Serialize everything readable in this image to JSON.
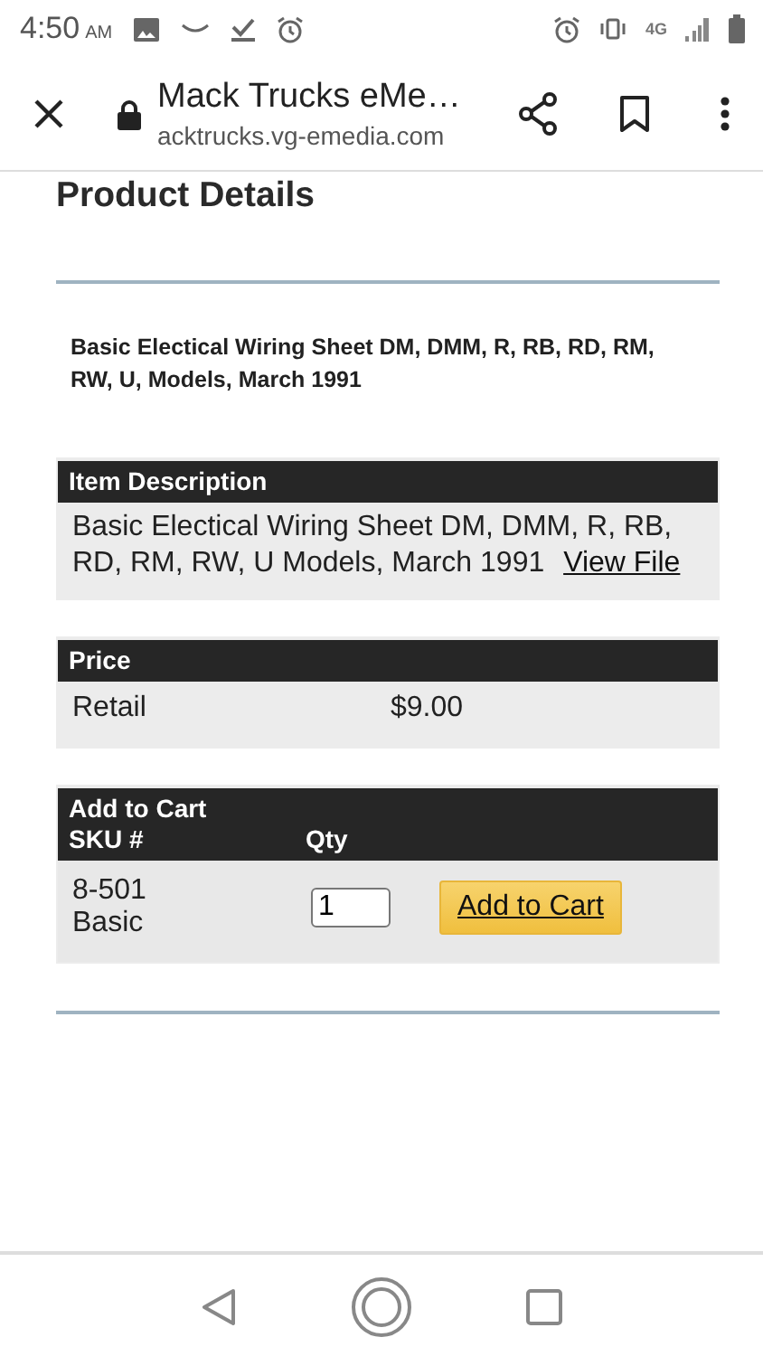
{
  "status_bar": {
    "time": "4:50",
    "ampm": "AM",
    "network": "4G"
  },
  "browser": {
    "title": "Mack Trucks eMe…",
    "url": "acktrucks.vg-emedia.com"
  },
  "page": {
    "heading": "Product Details",
    "product_title": "Basic Electical Wiring Sheet DM, DMM, R, RB, RD, RM, RW, U, Models, March 1991"
  },
  "item_description": {
    "header": "Item Description",
    "text": "Basic Electical Wiring Sheet DM, DMM, R, RB, RD, RM, RW, U Models, March 1991",
    "link": "View File"
  },
  "price": {
    "header": "Price",
    "label": "Retail",
    "value": "$9.00"
  },
  "cart": {
    "header": "Add to Cart",
    "columns": [
      "SKU #",
      "Qty"
    ],
    "sku": "8-501 Basic",
    "qty": "1",
    "button": "Add to Cart"
  }
}
